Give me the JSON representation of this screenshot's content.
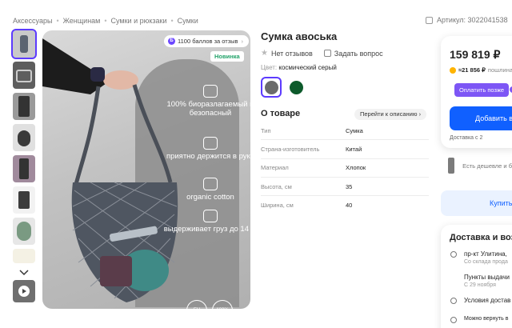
{
  "breadcrumbs": [
    "Аксессуары",
    "Женщинам",
    "Сумки и рюкзаки",
    "Сумки"
  ],
  "article": "Артикул: 3022041538",
  "gallery": {
    "points_badge": "1100 баллов за отзыв",
    "new_badge": "Новинка",
    "features": [
      {
        "text": "100% биоразлагаемый и безопасный",
        "icon": "recycle-icon"
      },
      {
        "text": "приятно держится в руке",
        "icon": "hand-icon"
      },
      {
        "text": "organic cotton",
        "icon": "cotton-icon"
      },
      {
        "text": "выдерживает груз до 14 кг",
        "icon": "weight-icon"
      }
    ],
    "seals": [
      "EU",
      "100%"
    ]
  },
  "product": {
    "title": "Сумка авоська",
    "reviews": "Нет отзывов",
    "ask": "Задать вопрос",
    "color_label": "Цвет:",
    "color_value": "космический серый",
    "swatches": [
      "#6b6b6b",
      "#0d5a2b"
    ]
  },
  "about": {
    "heading": "О товаре",
    "goto": "Перейти к описанию",
    "specs": [
      {
        "k": "Тип",
        "v": "Сумка"
      },
      {
        "k": "Страна-изготовитель",
        "v": "Китай"
      },
      {
        "k": "Материал",
        "v": "Хлопок"
      },
      {
        "k": "Высота, см",
        "v": "35"
      },
      {
        "k": "Ширина, см",
        "v": "40"
      }
    ]
  },
  "buy": {
    "price": "159 819 ₽",
    "points": "≈21 856 ₽",
    "points_note": "пошлина",
    "pay_label": "Оплатить позже",
    "add_label": "Добавить в",
    "delivery": "Доставка с 2"
  },
  "cheaper": "Есть дешевле и б",
  "oneclick": "Купить",
  "delivery_card": {
    "heading": "Доставка и воз",
    "address": "пр-кт Улитина,",
    "address_sub": "Со склада прода",
    "pickup": "Пункты выдачи",
    "pickup_sub": "С 29 ноября",
    "conditions": "Условия достав",
    "return": "Можно вернуть в"
  }
}
